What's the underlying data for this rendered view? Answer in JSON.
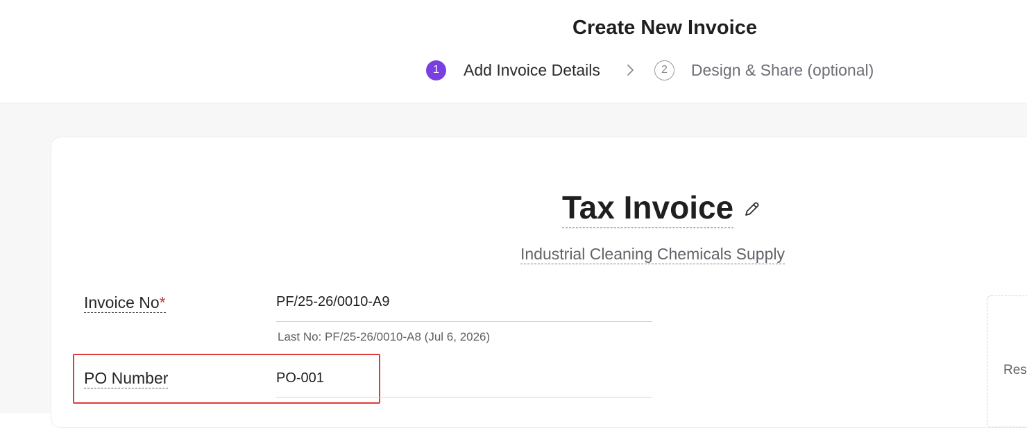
{
  "header": {
    "title": "Create New Invoice",
    "steps": [
      {
        "number": "1",
        "label": "Add Invoice Details",
        "active": true
      },
      {
        "number": "2",
        "label": "Design & Share (optional)",
        "active": false
      }
    ]
  },
  "invoice": {
    "title": "Tax Invoice",
    "subtitle": "Industrial Cleaning Chemicals Supply",
    "fields": {
      "invoice_no": {
        "label": "Invoice No",
        "required_mark": "*",
        "value": "PF/25-26/0010-A9",
        "hint": "Last No: PF/25-26/0010-A8 (Jul 6, 2026)"
      },
      "po_number": {
        "label": "PO Number",
        "value": "PO-001"
      }
    },
    "side_panel_text": "Res"
  },
  "colors": {
    "accent": "#7a3fe0",
    "highlight": "#e03a3a",
    "required": "#c0392b"
  },
  "icons": {
    "edit": "pencil-icon",
    "next": "chevron-right-icon"
  }
}
